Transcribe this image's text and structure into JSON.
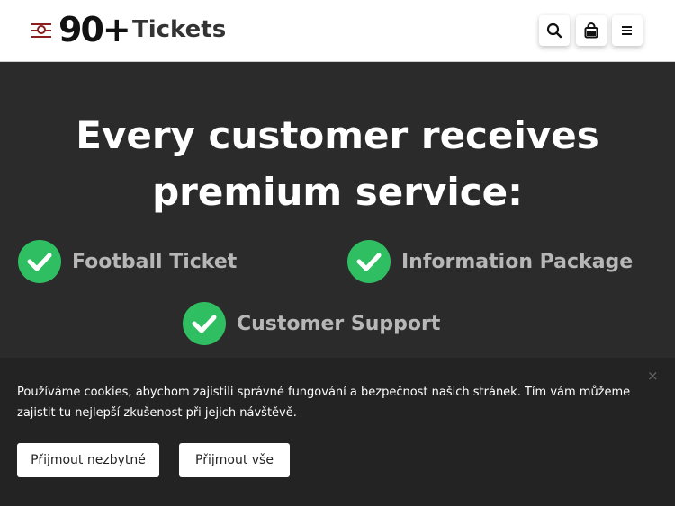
{
  "header": {
    "logo_text": "90+",
    "site_name": "Tickets",
    "icons": [
      "search-icon",
      "bag-icon",
      "menu-icon"
    ]
  },
  "hero": {
    "headline": "Every customer receives premium service:",
    "features": [
      {
        "label": "Football Ticket"
      },
      {
        "label": "Information Package"
      },
      {
        "label": "Customer Support"
      }
    ]
  },
  "cookie_banner": {
    "text": "Používáme cookies, abychom zajistili správné fungování a bezpečnost našich stránek. Tím vám můžeme zajistit tu nejlepší zkušenost při jejich návštěvě.",
    "close_symbol": "×",
    "accept_necessary_label": "Přijmout nezbytné",
    "accept_all_label": "Přijmout vše"
  },
  "colors": {
    "brand_red": "#8b1e1e",
    "check_green": "#2fbf62",
    "hero_bg": "#2b2b2b",
    "banner_bg": "#232323"
  }
}
